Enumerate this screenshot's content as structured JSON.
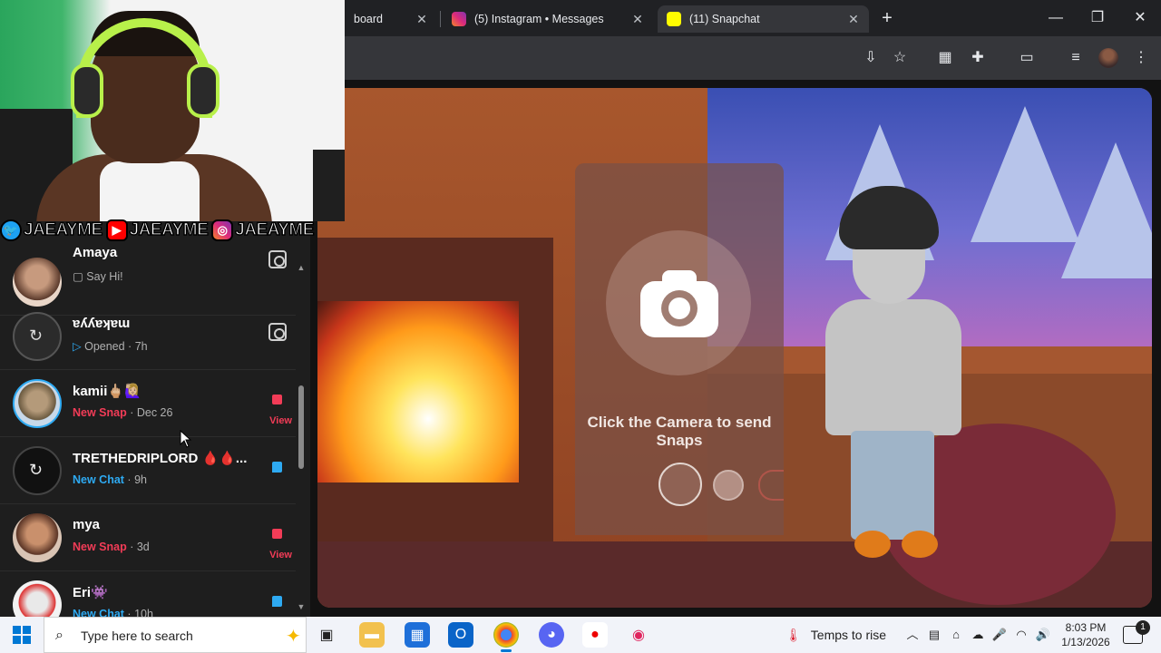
{
  "browser": {
    "tabs": [
      {
        "title": "board",
        "favicon": "dashboard-icon",
        "active": false
      },
      {
        "title": "(5) Instagram • Messages",
        "favicon": "instagram-icon",
        "active": false
      },
      {
        "title": "(11) Snapchat",
        "favicon": "snapchat-icon",
        "active": true
      }
    ],
    "close_glyph": "✕",
    "new_tab_glyph": "+",
    "window_controls": {
      "minimize": "—",
      "maximize": "❐",
      "close": "✕"
    },
    "toolbar_icons": [
      "install-icon",
      "star-icon",
      "qr-icon",
      "extensions-icon",
      "sidepanel-icon",
      "media-icon",
      "profile-avatar",
      "menu-icon"
    ]
  },
  "overlay": {
    "handles": [
      {
        "platform": "twitter",
        "glyph": "🐦",
        "text": "JAEAYME"
      },
      {
        "platform": "youtube",
        "glyph": "▶",
        "text": "JAEAYME"
      },
      {
        "platform": "instagram",
        "glyph": "◎",
        "text": "JAEAYME"
      }
    ]
  },
  "chat_list": {
    "items": [
      {
        "name": "Amaya",
        "status": "Say Hi!",
        "status_type": "grey",
        "time": "",
        "action": "camera",
        "view": ""
      },
      {
        "name": "ɐʎʎɐʞɐɯ",
        "status": "Opened",
        "status_type": "blue-outline",
        "time": "7h",
        "action": "camera",
        "view": ""
      },
      {
        "name": "kamii🖕🏼🙋🏼‍♀️",
        "status": "New Snap",
        "status_type": "red",
        "time": "Dec 26",
        "action": "snap",
        "view": "View"
      },
      {
        "name": "TRETHEDRIPLORD 🩸🩸...",
        "status": "New Chat",
        "status_type": "blue",
        "time": "9h",
        "action": "chat",
        "view": ""
      },
      {
        "name": "mya",
        "status": "New Snap",
        "status_type": "red",
        "time": "3d",
        "action": "snap",
        "view": "View"
      },
      {
        "name": "Eri👾",
        "status": "New Chat",
        "status_type": "blue",
        "time": "10h",
        "action": "chat",
        "view": ""
      }
    ],
    "separator": " · "
  },
  "camera_panel": {
    "prompt": "Click the Camera to send Snaps"
  },
  "taskbar": {
    "search_placeholder": "Type here to search",
    "weather": "Temps to rise",
    "time": "8:03 PM",
    "date": "1/13/2026",
    "notification_count": "1"
  },
  "colors": {
    "snap_red": "#f23c57",
    "chat_blue": "#2eaaf2",
    "headset_green": "#b8f04a",
    "snapchat_yellow": "#fffc00"
  }
}
